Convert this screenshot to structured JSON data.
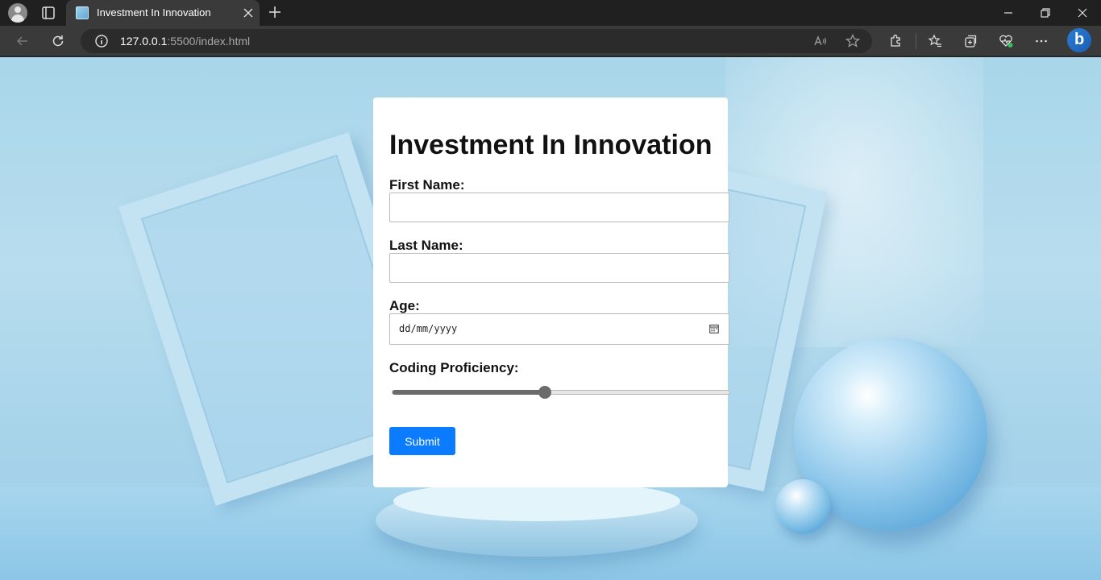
{
  "browser": {
    "tab": {
      "title": "Investment In Innovation"
    },
    "url": {
      "host": "127.0.0.1",
      "path": ":5500/index.html"
    }
  },
  "form": {
    "title": "Investment In Innovation",
    "first_name": {
      "label": "First Name:",
      "value": ""
    },
    "last_name": {
      "label": "Last Name:",
      "value": ""
    },
    "age": {
      "label": "Age:",
      "placeholder": "dd/mm/yyyy"
    },
    "coding_proficiency": {
      "label": "Coding Proficiency:",
      "value_fraction": 0.45
    },
    "submit_label": "Submit"
  },
  "colors": {
    "accent": "#0b7cff",
    "chrome_dark": "#202020",
    "toolbar": "#3a3a3a"
  }
}
